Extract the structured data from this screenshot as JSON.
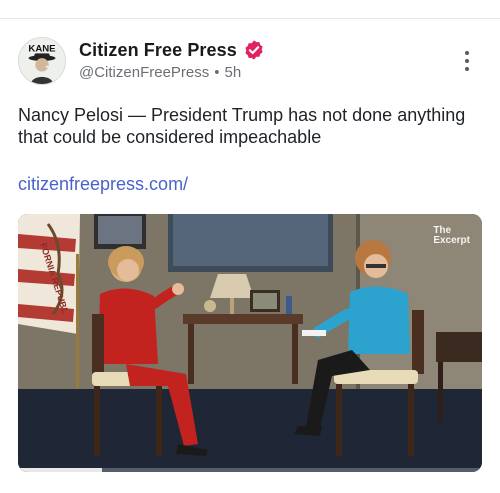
{
  "post": {
    "author": {
      "display_name": "Citizen Free Press",
      "handle": "@CitizenFreePress",
      "separator": "•",
      "timestamp": "5h",
      "verified": true,
      "avatar_text": "KANE"
    },
    "text": "Nancy Pelosi — President Trump has not done anything that could be considered impeachable",
    "link": "citizenfreepress.com/",
    "media": {
      "watermark_line1": "The",
      "watermark_line2": "Excerpt",
      "flag_text": "FORNIA REPUBL",
      "progress": 0.18
    }
  },
  "colors": {
    "verified_badge": "#e0245e",
    "link": "#4a62c9",
    "handle": "#6b6f74"
  },
  "icons": {
    "verified": "verified-badge-icon",
    "more": "more-vertical-icon"
  }
}
